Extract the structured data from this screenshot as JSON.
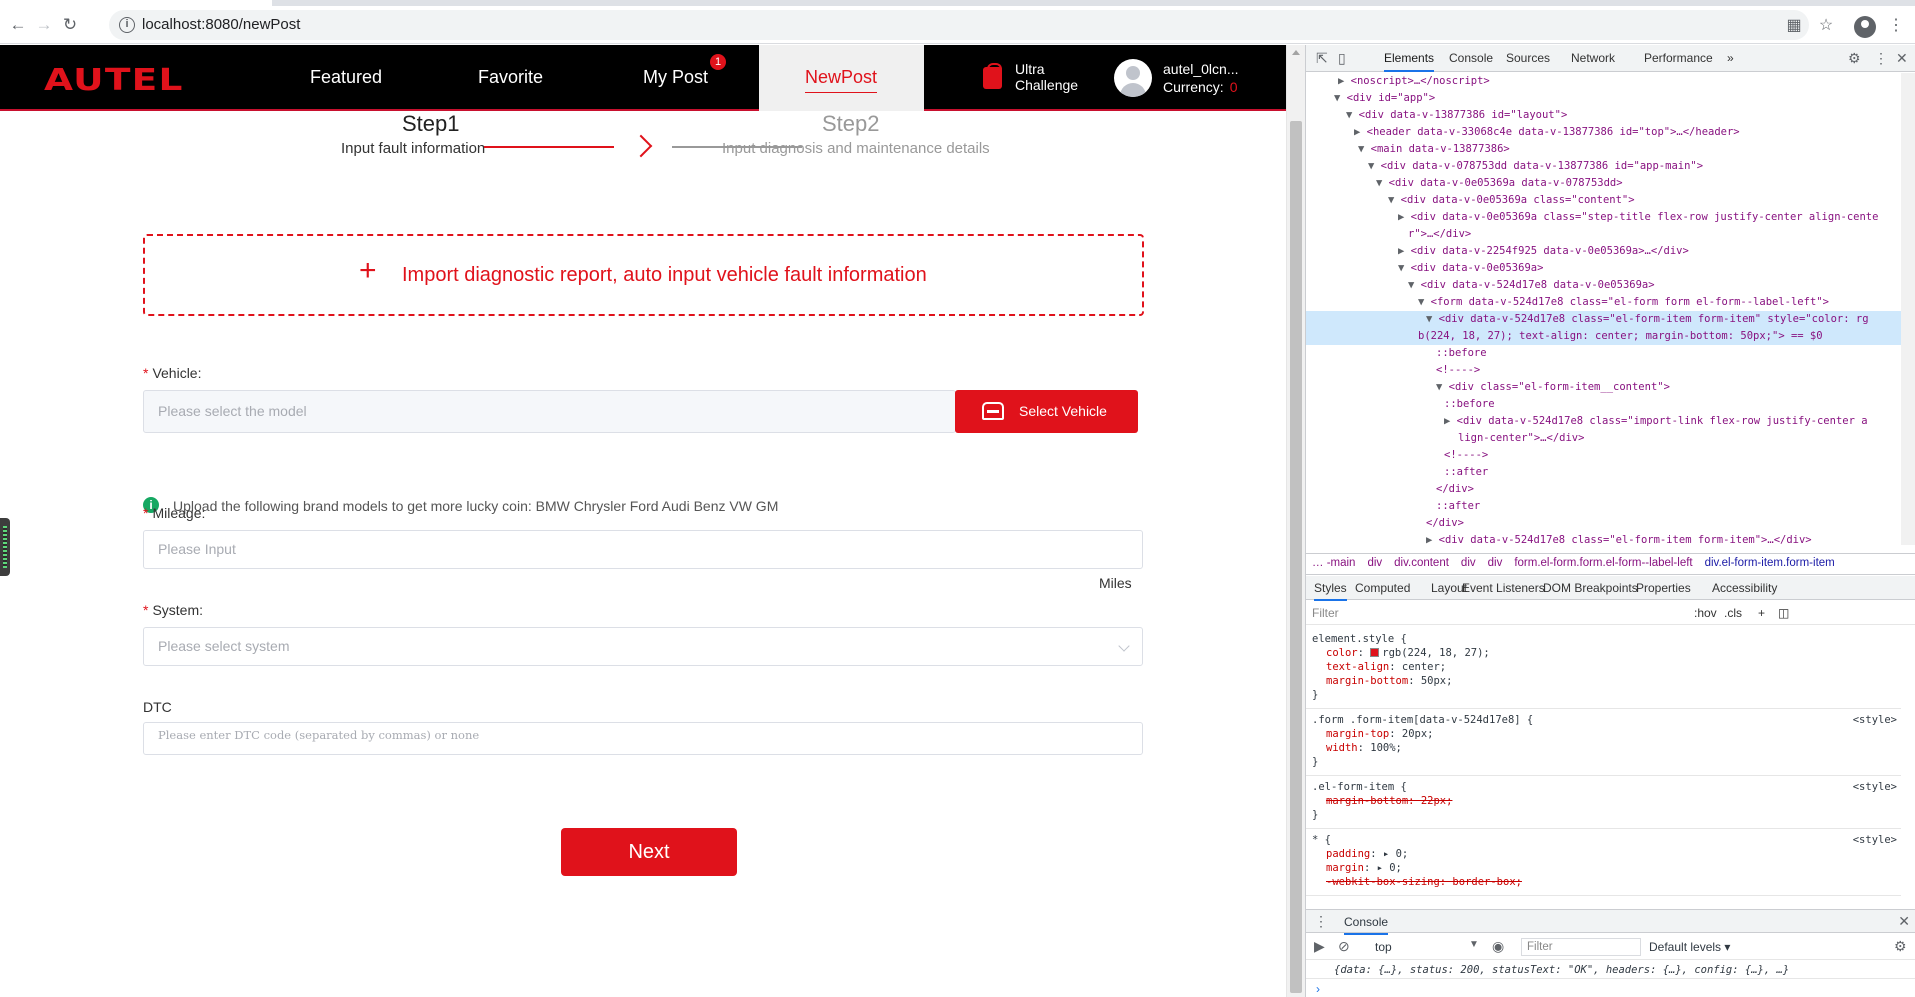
{
  "browser": {
    "url": "localhost:8080/newPost"
  },
  "header": {
    "logo": "AUTEL",
    "nav": [
      "Featured",
      "Favorite",
      "My Post",
      "NewPost"
    ],
    "mypost_badge": "1",
    "ultra_line1": "Ultra",
    "ultra_line2": "Challenge",
    "username": "autel_0lcn...",
    "currency_label": "Currency:",
    "currency_value": "0"
  },
  "steps": {
    "step1_title": "Step1",
    "step1_sub": "Input fault information",
    "step2_title": "Step2",
    "step2_sub": "Input diagnosis and maintenance details"
  },
  "form": {
    "import_plus": "+",
    "import_text": "Import diagnostic report, auto input vehicle fault information",
    "vehicle_label": "Vehicle:",
    "vehicle_placeholder": "Please select the model",
    "select_vehicle_btn": "Select Vehicle",
    "brand_hint": "Upload the following brand models to get more lucky coin: BMW Chrysler Ford Audi Benz VW GM",
    "mileage_label": "Mileage:",
    "mileage_placeholder": "Please Input",
    "mileage_unit": "Miles",
    "system_label": "System:",
    "system_placeholder": "Please select system",
    "dtc_label": "DTC",
    "dtc_placeholder": "Please enter DTC code (separated by commas) or none",
    "required_mark": "*",
    "next_btn": "Next"
  },
  "devtools": {
    "tabs": [
      "Elements",
      "Console",
      "Sources",
      "Network",
      "Performance"
    ],
    "more": "»",
    "dom_lines": [
      {
        "t": "<noscript>…</noscript>"
      },
      {
        "t": "<div id=\"app\">"
      },
      {
        "t": "<div data-v-13877386 id=\"layout\">"
      },
      {
        "t": "<header data-v-33068c4e data-v-13877386 id=\"top\">…</header>"
      },
      {
        "t": "<main data-v-13877386>"
      },
      {
        "t": "<div data-v-078753dd data-v-13877386 id=\"app-main\">"
      },
      {
        "t": "<div data-v-0e05369a data-v-078753dd>"
      },
      {
        "t": "<div data-v-0e05369a class=\"content\">"
      },
      {
        "t": "<div data-v-0e05369a class=\"step-title flex-row justify-center align-cente"
      },
      {
        "t": "r\">…</div>"
      },
      {
        "t": "<div data-v-2254f925 data-v-0e05369a>…</div>"
      },
      {
        "t": "<div data-v-0e05369a>"
      },
      {
        "t": "<div data-v-524d17e8 data-v-0e05369a>"
      },
      {
        "t": "<form data-v-524d17e8 class=\"el-form form el-form--label-left\">"
      },
      {
        "t": "<div data-v-524d17e8 class=\"el-form-item form-item\" style=\"color: rg"
      },
      {
        "t": "b(224, 18, 27); text-align: center; margin-bottom: 50px;\"> == $0"
      },
      {
        "t": "::before"
      },
      {
        "t": "<!---->"
      },
      {
        "t": "<div class=\"el-form-item__content\">"
      },
      {
        "t": "::before"
      },
      {
        "t": "<div data-v-524d17e8 class=\"import-link flex-row justify-center a"
      },
      {
        "t": "lign-center\">…</div>"
      },
      {
        "t": "<!---->"
      },
      {
        "t": "::after"
      },
      {
        "t": "</div>"
      },
      {
        "t": "::after"
      },
      {
        "t": "</div>"
      },
      {
        "t": "<div data-v-524d17e8 class=\"el-form-item form-item\">…</div>"
      }
    ],
    "crumbs": [
      "… -main",
      "div",
      "div.content",
      "div",
      "div",
      "form.el-form.form.el-form--label-left",
      "div.el-form-item.form-item"
    ],
    "style_tabs": [
      "Styles",
      "Computed",
      "Layout",
      "Event Listeners",
      "DOM Breakpoints",
      "Properties",
      "Accessibility"
    ],
    "filter_placeholder": "Filter",
    "hov": ":hov",
    "cls": ".cls",
    "rules": {
      "r1_sel": "element.style {",
      "r1_color": "rgb(224, 18, 27);",
      "r1_align": "center;",
      "r1_mb": "50px;",
      "r2_sel": ".form .form-item[data-v-524d17e8] {",
      "r2_mt": "20px;",
      "r2_w": "100%;",
      "r3_sel": ".el-form-item {",
      "r3_mb": "margin-bottom: 22px;",
      "r4_sel": "* {",
      "r4_pad": "0;",
      "r4_mar": "0;",
      "r4_box": "-webkit-box-sizing: border-box;",
      "src": "<style>"
    },
    "console_tab": "Console",
    "context": "top",
    "console_filter": "Filter",
    "levels": "Default levels ▾",
    "console_output": "{data: {…}, status: 200, statusText: \"OK\", headers: {…}, config: {…}, …}"
  }
}
